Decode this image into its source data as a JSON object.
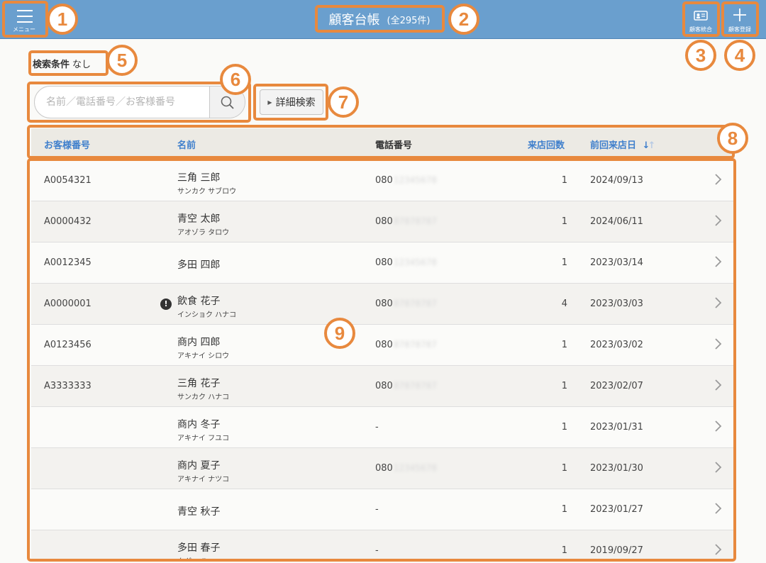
{
  "header": {
    "menu_label": "メニュー",
    "title": "顧客台帳",
    "count": "(全295件)",
    "merge_label": "顧客統合",
    "register_label": "顧客登録",
    "bg_color": "#6a9fce"
  },
  "conditions": {
    "label": "検索条件",
    "value": "なし"
  },
  "search": {
    "placeholder": "名前／電話番号／お客様番号",
    "value": "",
    "icon": "search-icon"
  },
  "detail_search": {
    "label": "詳細検索"
  },
  "table": {
    "headers": {
      "customer_no": "お客様番号",
      "name": "名前",
      "phone": "電話番号",
      "visits": "来店回数",
      "last_visit": "前回来店日"
    },
    "rows": [
      {
        "id": "A0054321",
        "name": "三角 三郎",
        "kana": "サンカク サブロウ",
        "phone_prefix": "080",
        "phone_masked": "12345678",
        "visits": "1",
        "last_visit": "2024/09/13",
        "warning": false
      },
      {
        "id": "A0000432",
        "name": "青空 太郎",
        "kana": "アオゾラ タロウ",
        "phone_prefix": "080",
        "phone_masked": "87878787",
        "visits": "1",
        "last_visit": "2024/06/11",
        "warning": false
      },
      {
        "id": "A0012345",
        "name": "多田 四郎",
        "kana": "",
        "phone_prefix": "080",
        "phone_masked": "12345678",
        "visits": "1",
        "last_visit": "2023/03/14",
        "warning": false
      },
      {
        "id": "A0000001",
        "name": "飲食 花子",
        "kana": "インショク ハナコ",
        "phone_prefix": "080",
        "phone_masked": "87878787",
        "visits": "4",
        "last_visit": "2023/03/03",
        "warning": true
      },
      {
        "id": "A0123456",
        "name": "商内 四郎",
        "kana": "アキナイ シロウ",
        "phone_prefix": "080",
        "phone_masked": "87878787",
        "visits": "1",
        "last_visit": "2023/03/02",
        "warning": false
      },
      {
        "id": "A3333333",
        "name": "三角 花子",
        "kana": "サンカク ハナコ",
        "phone_prefix": "080",
        "phone_masked": "87878787",
        "visits": "1",
        "last_visit": "2023/02/07",
        "warning": false
      },
      {
        "id": "",
        "name": "商内 冬子",
        "kana": "アキナイ フユコ",
        "phone_prefix": "-",
        "phone_masked": "",
        "visits": "1",
        "last_visit": "2023/01/31",
        "warning": false
      },
      {
        "id": "",
        "name": "商内 夏子",
        "kana": "アキナイ ナツコ",
        "phone_prefix": "080",
        "phone_masked": "12345678",
        "visits": "1",
        "last_visit": "2023/01/30",
        "warning": false
      },
      {
        "id": "",
        "name": "青空 秋子",
        "kana": "",
        "phone_prefix": "-",
        "phone_masked": "",
        "visits": "1",
        "last_visit": "2023/01/27",
        "warning": false
      },
      {
        "id": "",
        "name": "多田 春子",
        "kana": "タダ ハルコ",
        "phone_prefix": "-",
        "phone_masked": "",
        "visits": "1",
        "last_visit": "2019/09/27",
        "warning": false
      }
    ]
  },
  "annotations": [
    "1",
    "2",
    "3",
    "4",
    "5",
    "6",
    "7",
    "8",
    "9"
  ],
  "annotation_color": "#e8893e"
}
